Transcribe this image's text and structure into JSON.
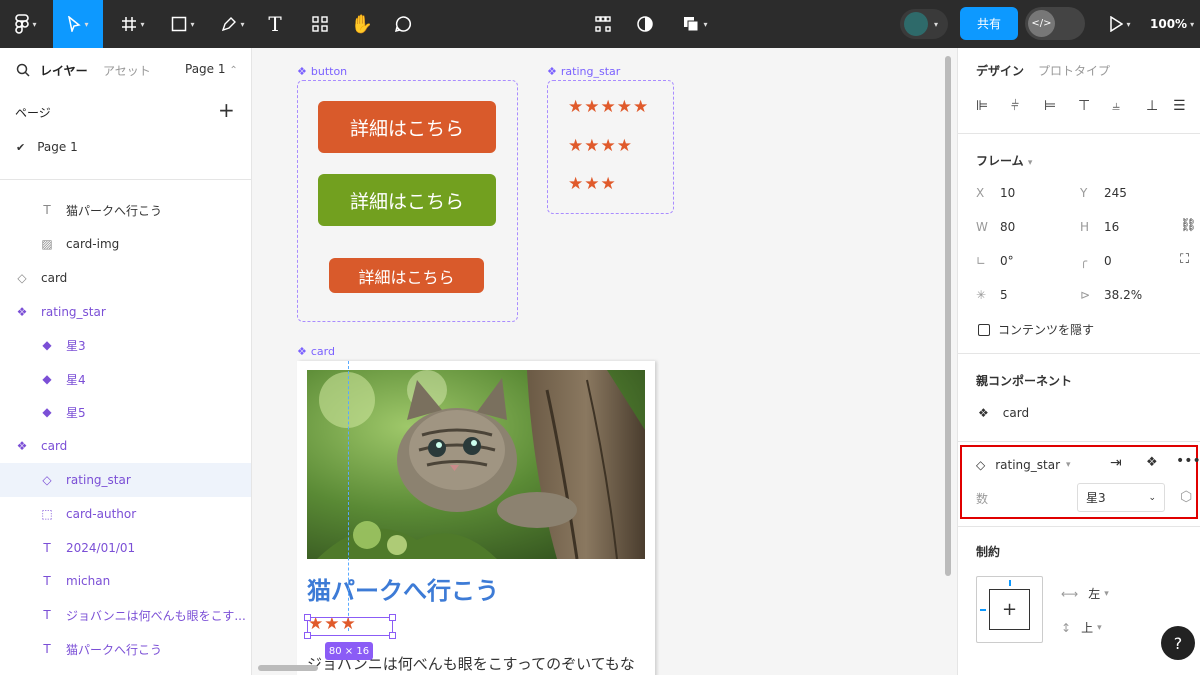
{
  "toolbar": {
    "share_label": "共有",
    "zoom_label": "100%"
  },
  "left_panel": {
    "tabs": {
      "layers": "レイヤー",
      "assets": "アセット",
      "page_selector": "Page 1"
    },
    "pages_header": "ページ",
    "pages": [
      {
        "label": "Page 1"
      }
    ],
    "layers": [
      {
        "label": "猫パークへ行こう",
        "icon": "text-icon"
      },
      {
        "label": "card-img",
        "icon": "image-icon"
      },
      {
        "label": "card",
        "icon": "instance-icon"
      },
      {
        "label": "rating_star",
        "icon": "component-icon"
      },
      {
        "label": "星3",
        "icon": "variant-icon"
      },
      {
        "label": "星4",
        "icon": "variant-icon"
      },
      {
        "label": "星5",
        "icon": "variant-icon"
      },
      {
        "label": "card",
        "icon": "component-icon"
      },
      {
        "label": "rating_star",
        "icon": "instance-icon"
      },
      {
        "label": "card-author",
        "icon": "frame-icon"
      },
      {
        "label": "2024/01/01",
        "icon": "text-icon"
      },
      {
        "label": "michan",
        "icon": "text-icon"
      },
      {
        "label": "ジョバンニは何べんも眼をこす...",
        "icon": "text-icon"
      },
      {
        "label": "猫パークへ行こう",
        "icon": "text-icon"
      }
    ]
  },
  "canvas": {
    "button_label": "button",
    "rating_label": "rating_star",
    "card_label": "card",
    "buttons": [
      {
        "text": "詳細はこちら",
        "color": "#d95a2b"
      },
      {
        "text": "詳細はこちら",
        "color": "#72a01f"
      },
      {
        "text": "詳細はこちら",
        "color": "#d95a2b"
      }
    ],
    "ratings": [
      {
        "stars": 5
      },
      {
        "stars": 4
      },
      {
        "stars": 3
      }
    ],
    "card": {
      "title": "猫パークへ行こう",
      "text": "ジョバンニは何べんも眼をこすってのぞいてもな",
      "rating_stars": 3
    },
    "selection_size": "80 × 16"
  },
  "right_panel": {
    "tabs": {
      "design": "デザイン",
      "prototype": "プロトタイプ"
    },
    "frame_header": "フレーム",
    "fields": {
      "x": "10",
      "y": "245",
      "w": "80",
      "h": "16",
      "rotation": "0°",
      "radius": "0",
      "points": "5",
      "ratio": "38.2%"
    },
    "hide_content_label": "コンテンツを隠す",
    "parent_header": "親コンポーネント",
    "parent_name": "card",
    "instance_name": "rating_star",
    "prop_label": "数",
    "prop_value": "星3",
    "constraints_header": "制約",
    "constraint_h": "左",
    "constraint_v": "上",
    "help": "?"
  }
}
